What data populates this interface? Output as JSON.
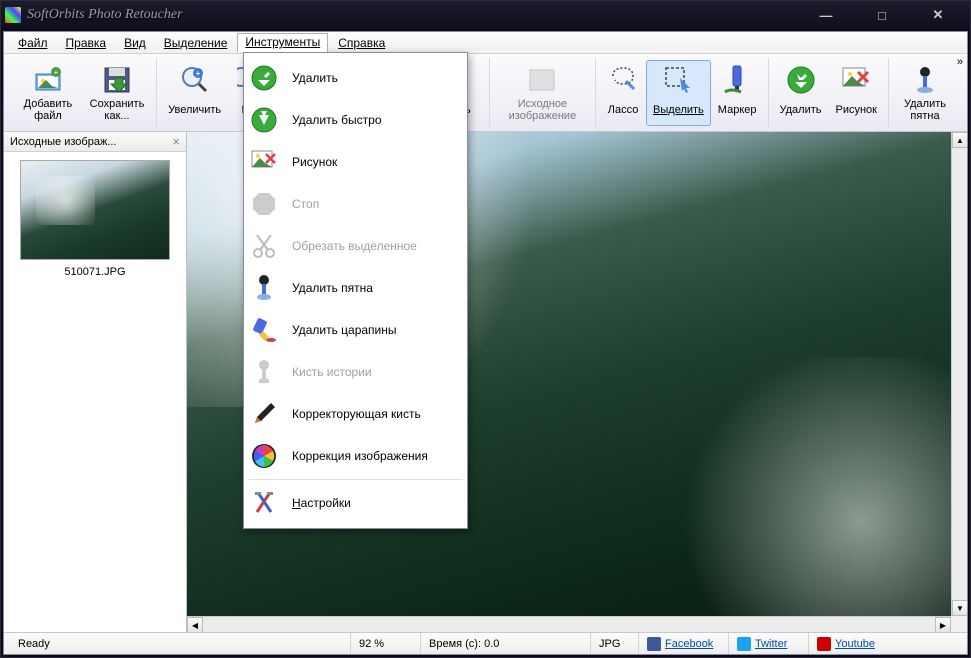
{
  "title": "SoftOrbits Photo Retoucher",
  "menubar": {
    "file": "Файл",
    "edit": "Правка",
    "view": "Вид",
    "selection": "Выделение",
    "tools": "Инструменты",
    "help": "Справка"
  },
  "toolbar": {
    "add_file": "Добавить файл",
    "save_as": "Сохранить как...",
    "zoom": "Увеличить",
    "fit_cut1": "В",
    "fit_cut2": "ор",
    "cut3": "ь",
    "original": "Исходное изображение",
    "lasso": "Лассо",
    "select": "Выделить",
    "marker": "Маркер",
    "remove": "Удалить",
    "picture": "Рисунок",
    "remove_spots": "Удалить пятна"
  },
  "dropdown": {
    "remove": "Удалить",
    "remove_fast": "Удалить быстро",
    "picture": "Рисунок",
    "stop": "Стоп",
    "crop_sel": "Обрезать выделенное",
    "remove_spots": "Удалить пятна",
    "remove_scratches": "Удалить царапины",
    "history_brush": "Кисть истории",
    "healing_brush": "Корректорующая кисть",
    "image_correction": "Коррекция изображения",
    "settings": "Настройки"
  },
  "sidebar": {
    "tab_title": "Исходные изображ...",
    "thumb_filename": "510071.JPG"
  },
  "status": {
    "ready": "Ready",
    "zoom": "92 %",
    "time": "Время (с): 0.0",
    "format": "JPG",
    "facebook": "Facebook",
    "twitter": "Twitter",
    "youtube": "Youtube"
  }
}
